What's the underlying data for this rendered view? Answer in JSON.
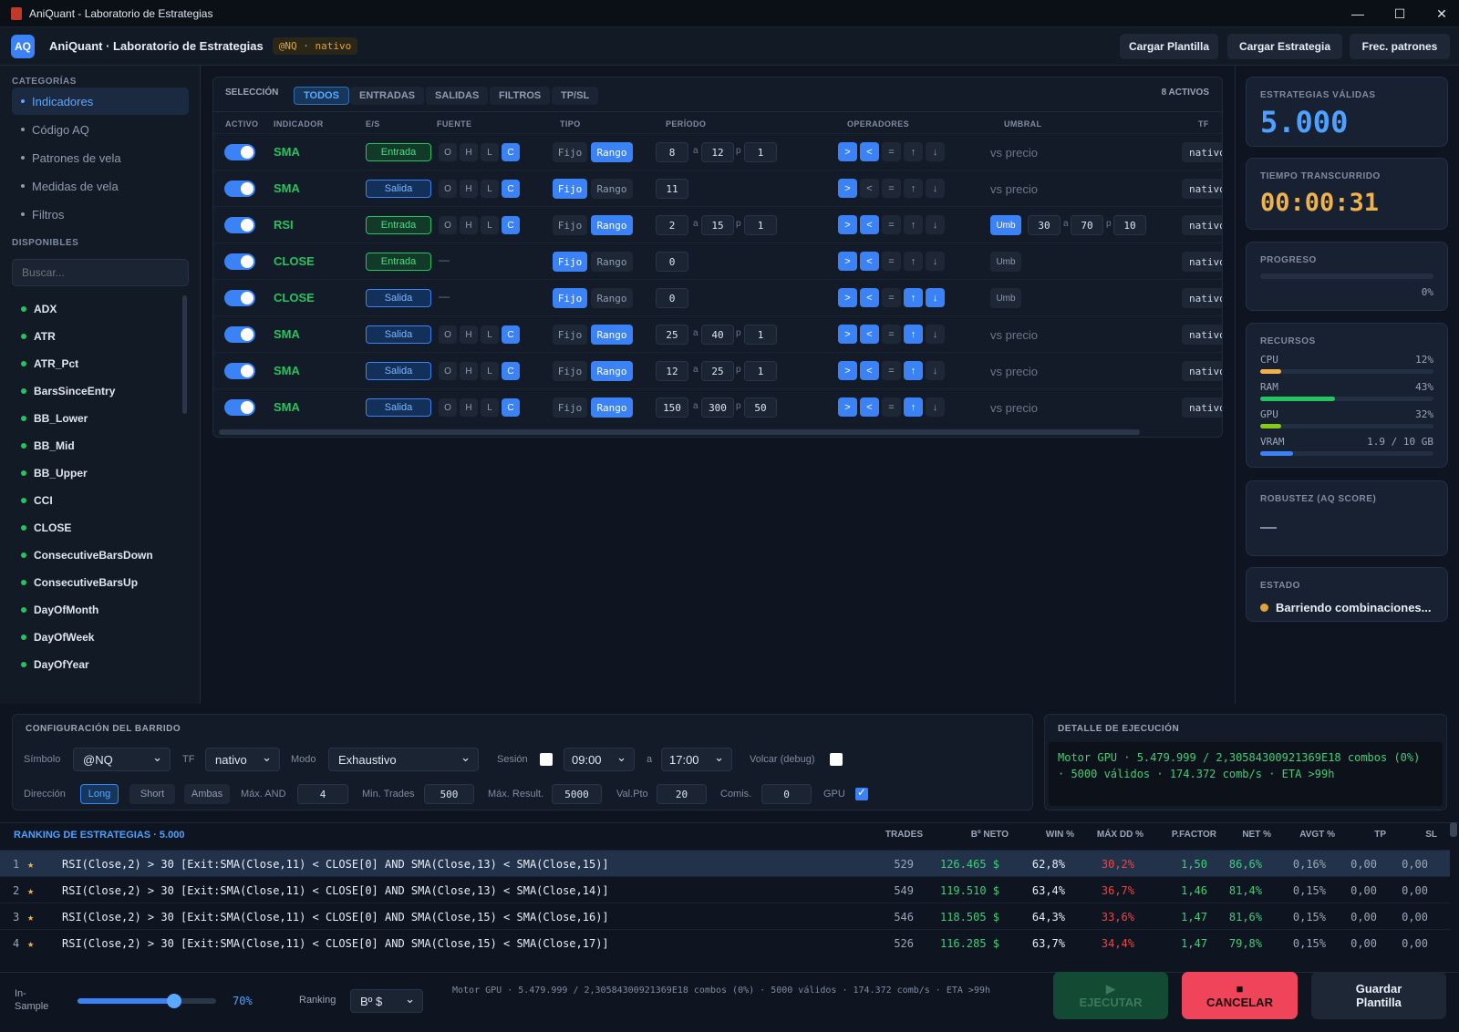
{
  "window": {
    "title": "AniQuant  -  Laboratorio de Estrategias",
    "controls": [
      "—",
      "☐",
      "✕"
    ]
  },
  "appbar": {
    "logo": "AQ",
    "title": "AniQuant · Laboratorio de Estrategias",
    "symbol_tag": "@NQ · nativo",
    "buttons": [
      "Cargar Plantilla",
      "Cargar Estrategia",
      "Frec. patrones"
    ]
  },
  "sidebar": {
    "categories_label": "CATEGORÍAS",
    "categories": [
      "Indicadores",
      "Código AQ",
      "Patrones de vela",
      "Medidas de vela",
      "Filtros"
    ],
    "active_category": "Indicadores",
    "available_label": "DISPONIBLES",
    "search_placeholder": "Buscar...",
    "available": [
      "ADX",
      "ATR",
      "ATR_Pct",
      "BarsSinceEntry",
      "BB_Lower",
      "BB_Mid",
      "BB_Upper",
      "CCI",
      "CLOSE",
      "ConsecutiveBarsDown",
      "ConsecutiveBarsUp",
      "DayOfMonth",
      "DayOfWeek",
      "DayOfYear"
    ]
  },
  "selection": {
    "label": "SELECCIÓN",
    "filters": [
      "TODOS",
      "ENTRADAS",
      "SALIDAS",
      "FILTROS",
      "TP/SL"
    ],
    "active_filter": "TODOS",
    "active_count": "8 ACTIVOS",
    "columns": [
      "ACTIVO",
      "INDICADOR",
      "E/S",
      "FUENTE",
      "TIPO",
      "PERÍODO",
      "OPERADORES",
      "UMBRAL",
      "TF"
    ],
    "sources": [
      "O",
      "H",
      "L",
      "C"
    ],
    "types": [
      "Fijo",
      "Rango"
    ],
    "operators": [
      ">",
      "<",
      "=",
      "↑",
      "↓"
    ],
    "range_sep": "a",
    "step_sep": "p",
    "rows": [
      {
        "active": true,
        "indicator": "SMA",
        "es": "Entrada",
        "source": "C",
        "tipo": "Rango",
        "period": [
          "8",
          "12",
          "1"
        ],
        "ops_on": [
          0,
          1
        ],
        "threshold": "vs precio",
        "tf": "nativo"
      },
      {
        "active": true,
        "indicator": "SMA",
        "es": "Salida",
        "source": "C",
        "tipo": "Fijo",
        "period": [
          "11"
        ],
        "ops_on": [
          0
        ],
        "threshold": "vs precio",
        "tf": "nativo"
      },
      {
        "active": true,
        "indicator": "RSI",
        "es": "Entrada",
        "source": "C",
        "tipo": "Rango",
        "period": [
          "2",
          "15",
          "1"
        ],
        "ops_on": [
          0,
          1
        ],
        "threshold": "Umb",
        "umb_on": true,
        "umb_vals": [
          "30",
          "70",
          "10"
        ],
        "tf": "nativo"
      },
      {
        "active": true,
        "indicator": "CLOSE",
        "es": "Entrada",
        "source": "",
        "tipo": "Fijo",
        "period": [
          "0"
        ],
        "ops_on": [
          0,
          1
        ],
        "threshold": "Umb",
        "umb_on": false,
        "tf": "nativo"
      },
      {
        "active": true,
        "indicator": "CLOSE",
        "es": "Salida",
        "source": "",
        "tipo": "Fijo",
        "period": [
          "0"
        ],
        "ops_on": [
          0,
          1,
          3,
          4
        ],
        "threshold": "Umb",
        "umb_on": false,
        "tf": "nativo"
      },
      {
        "active": true,
        "indicator": "SMA",
        "es": "Salida",
        "source": "C",
        "tipo": "Rango",
        "period": [
          "25",
          "40",
          "1"
        ],
        "ops_on": [
          0,
          1,
          3
        ],
        "threshold": "vs precio",
        "tf": "nativo"
      },
      {
        "active": true,
        "indicator": "SMA",
        "es": "Salida",
        "source": "C",
        "tipo": "Rango",
        "period": [
          "12",
          "25",
          "1"
        ],
        "ops_on": [
          0,
          1,
          3
        ],
        "threshold": "vs precio",
        "tf": "nativo"
      },
      {
        "active": true,
        "indicator": "SMA",
        "es": "Salida",
        "source": "C",
        "tipo": "Rango",
        "period": [
          "150",
          "300",
          "50"
        ],
        "ops_on": [
          0,
          1,
          3
        ],
        "threshold": "vs precio",
        "tf": "nativo"
      }
    ]
  },
  "stats": {
    "valid_label": "ESTRATEGIAS VÁLIDAS",
    "valid_value": "5.000",
    "time_label": "TIEMPO TRANSCURRIDO",
    "time_value": "00:00:31",
    "progress_label": "PROGRESO",
    "progress_pct": "0%",
    "progress_fraction": 0,
    "resources_label": "RECURSOS",
    "resources": [
      {
        "name": "CPU",
        "value": "12%",
        "fraction": 0.12,
        "color": "#f2b24a"
      },
      {
        "name": "RAM",
        "value": "43%",
        "fraction": 0.43,
        "color": "#22c55e"
      },
      {
        "name": "GPU",
        "value": "32%",
        "fraction": 0.12,
        "color": "#84cc16"
      },
      {
        "name": "VRAM",
        "value": "1.9 / 10 GB",
        "fraction": 0.19,
        "color": "#3b82f6"
      }
    ],
    "robust_label": "ROBUSTEZ (AQ SCORE)",
    "state_label": "ESTADO",
    "state_value": "Barriendo combinaciones..."
  },
  "config": {
    "title": "CONFIGURACIÓN DEL BARRIDO",
    "symbol_label": "Símbolo",
    "symbol": "@NQ",
    "tf_label": "TF",
    "tf": "nativo",
    "mode_label": "Modo",
    "mode": "Exhaustivo",
    "session_label": "Sesión",
    "session_from": "09:00",
    "session_sep": "a",
    "session_to": "17:00",
    "dump_label": "Volcar (debug)",
    "direction_label": "Dirección",
    "directions": [
      "Long",
      "Short",
      "Ambas"
    ],
    "direction_active": "Long",
    "max_and_label": "Máx. AND",
    "max_and": "4",
    "min_trades_label": "Min. Trades",
    "min_trades": "500",
    "max_result_label": "Máx. Result.",
    "max_result": "5000",
    "valpto_label": "Val.Pto",
    "valpto": "20",
    "comis_label": "Comis.",
    "comis": "0",
    "gpu_label": "GPU",
    "gpu": true
  },
  "execution": {
    "title": "DETALLE DE EJECUCIÓN",
    "line1": "Motor GPU  ·  5.479.999 / 2,30584300921369E18 combos (0%)",
    "line2": "·  5000 válidos  ·  174.372 comb/s  ·  ETA >99h"
  },
  "ranking": {
    "title": "RANKING DE ESTRATEGIAS · 5.000",
    "columns": [
      "TRADES",
      "Bº NETO",
      "WIN %",
      "MÁX DD %",
      "P.FACTOR",
      "NET %",
      "AVGT %",
      "TP",
      "SL"
    ],
    "rows": [
      {
        "n": "1",
        "name": "RSI(Close,2) > 30 [Exit:SMA(Close,11) < CLOSE[0] AND SMA(Close,13) < SMA(Close,15)]",
        "trades": "529",
        "neto": "126.465 $",
        "win": "62,8%",
        "dd": "30,2%",
        "pf": "1,50",
        "net": "86,6%",
        "avgt": "0,16%",
        "tp": "0,00",
        "sl": "0,00"
      },
      {
        "n": "2",
        "name": "RSI(Close,2) > 30 [Exit:SMA(Close,11) < CLOSE[0] AND SMA(Close,13) < SMA(Close,14)]",
        "trades": "549",
        "neto": "119.510 $",
        "win": "63,4%",
        "dd": "36,7%",
        "pf": "1,46",
        "net": "81,4%",
        "avgt": "0,15%",
        "tp": "0,00",
        "sl": "0,00"
      },
      {
        "n": "3",
        "name": "RSI(Close,2) > 30 [Exit:SMA(Close,11) < CLOSE[0] AND SMA(Close,15) < SMA(Close,16)]",
        "trades": "546",
        "neto": "118.505 $",
        "win": "64,3%",
        "dd": "33,6%",
        "pf": "1,47",
        "net": "81,6%",
        "avgt": "0,15%",
        "tp": "0,00",
        "sl": "0,00"
      },
      {
        "n": "4",
        "name": "RSI(Close,2) > 30 [Exit:SMA(Close,11) < CLOSE[0] AND SMA(Close,15) < SMA(Close,17)]",
        "trades": "526",
        "neto": "116.285 $",
        "win": "63,7%",
        "dd": "34,4%",
        "pf": "1,47",
        "net": "79,8%",
        "avgt": "0,15%",
        "tp": "0,00",
        "sl": "0,00"
      }
    ]
  },
  "footer": {
    "insample_label": "In-Sample",
    "insample_value": "70%",
    "insample_fraction": 0.7,
    "ranking_label": "Ranking",
    "ranking_value": "Bº $",
    "status": "Motor GPU · 5.479.999 / 2,30584300921369E18 combos (0%) · 5000 válidos · 174.372 comb/s · ETA >99h",
    "run_icon": "▶",
    "run": "EJECUTAR",
    "cancel_icon": "■",
    "cancel": "CANCELAR",
    "save": "Guardar Plantilla"
  },
  "colors": {
    "accent": "#3b82f6",
    "green": "#22c55e",
    "red": "#ef4444",
    "amber": "#f2b24a"
  }
}
